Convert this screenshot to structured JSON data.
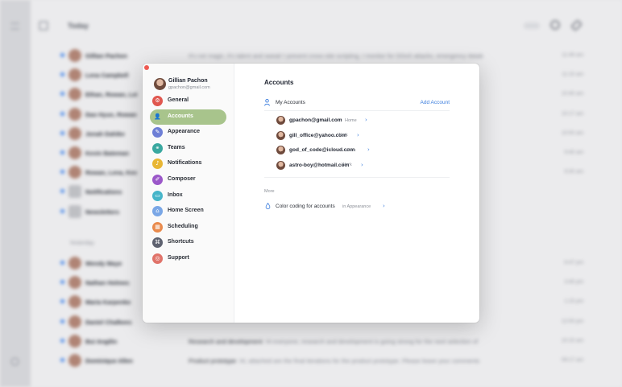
{
  "background": {
    "title": "Today",
    "section_yesterday": "Yesterday",
    "rows_today": [
      {
        "from": "Gillian Pachon",
        "subject": "",
        "preview": "It's not magic, it's talent and sweat! I prevent cross-site scripting, I monitor for DDoS attacks, emergency datab",
        "time": "11:49 am",
        "group": false
      },
      {
        "from": "Lena Campbell",
        "subject": "",
        "preview": "ewed. It seems as t",
        "time": "11:15 am",
        "group": false
      },
      {
        "from": "Ethan, Rowan, Lei",
        "subject": "",
        "preview": "Google, lowercase",
        "time": "10:45 am",
        "group": false
      },
      {
        "from": "Dao Hyun, Rowan",
        "subject": "",
        "preview": "bout all the late",
        "time": "10:17 am",
        "group": false
      },
      {
        "from": "Jonah Dahike",
        "subject": "",
        "preview": "",
        "time": "10:00 am",
        "group": false
      },
      {
        "from": "Kevin Bateman",
        "subject": "",
        "preview": "to be done today",
        "time": "9:45 am",
        "group": false
      },
      {
        "from": "Rowan, Lena, Kev",
        "subject": "",
        "preview": "",
        "time": "9:30 am",
        "group": false
      },
      {
        "from": "Notifications",
        "subject": "",
        "preview": "",
        "time": "",
        "group": true
      },
      {
        "from": "Newsletters",
        "subject": "",
        "preview": "",
        "time": "",
        "group": true
      }
    ],
    "rows_yesterday": [
      {
        "from": "Wendy Maye",
        "subject": "",
        "preview": "ant tone and explor",
        "time": "6:47 pm"
      },
      {
        "from": "Nathan Holmes",
        "subject": "",
        "preview": "ed and wanted to",
        "time": "3:45 pm"
      },
      {
        "from": "Maria Karpenko",
        "subject": "",
        "preview": "nmation material for tod",
        "time": "1:15 pm"
      },
      {
        "from": "Daniel Chalkees",
        "subject": "",
        "preview": "",
        "time": "12:00 pm"
      },
      {
        "from": "Bui Angilin",
        "subject": "Research and development",
        "preview": "Hi everyone, research and development is going strong for the next selection of",
        "time": "10:15 am"
      },
      {
        "from": "Dominique Allen",
        "subject": "Product prototype",
        "preview": "Hi, attached are the final iterations for the product prototype. Please leave your comments",
        "time": "09:17 am"
      }
    ]
  },
  "dialog": {
    "user": {
      "name": "Gillian Pachon",
      "email": "gpachon@gmail.com"
    },
    "nav": [
      {
        "label": "General",
        "icon": "gear-icon",
        "glyph": "⚙",
        "color": "#e0574f",
        "active": false
      },
      {
        "label": "Accounts",
        "icon": "person-icon",
        "glyph": "👤",
        "color": "#a8c48c",
        "active": true
      },
      {
        "label": "Appearance",
        "icon": "brush-icon",
        "glyph": "✎",
        "color": "#6e7fd6",
        "active": false
      },
      {
        "label": "Teams",
        "icon": "team-icon",
        "glyph": "⚭",
        "color": "#3aa8a0",
        "active": false
      },
      {
        "label": "Notifications",
        "icon": "bell-icon",
        "glyph": "♪",
        "color": "#e8b634",
        "active": false
      },
      {
        "label": "Composer",
        "icon": "pencil-icon",
        "glyph": "✐",
        "color": "#9b58c9",
        "active": false
      },
      {
        "label": "Inbox",
        "icon": "inbox-icon",
        "glyph": "▭",
        "color": "#46b5c9",
        "active": false
      },
      {
        "label": "Home Screen",
        "icon": "home-icon",
        "glyph": "⌂",
        "color": "#7aa7e6",
        "active": false
      },
      {
        "label": "Scheduling",
        "icon": "calendar-icon",
        "glyph": "▦",
        "color": "#e98a4c",
        "active": false
      },
      {
        "label": "Shortcuts",
        "icon": "command-icon",
        "glyph": "⌘",
        "color": "#5e6270",
        "active": false
      },
      {
        "label": "Support",
        "icon": "lifebuoy-icon",
        "glyph": "◎",
        "color": "#e0736a",
        "active": false
      }
    ],
    "main": {
      "heading": "Accounts",
      "my_accounts_label": "My Accounts",
      "add_account_label": "Add Account",
      "accounts": [
        {
          "email": "gpachon@gmail.com",
          "tag": "Home"
        },
        {
          "email": "gill_office@yahoo.com",
          "tag": "Work"
        },
        {
          "email": "god_of_code@icloud.com",
          "tag": "Work"
        },
        {
          "email": "astro-boy@hotmail.com",
          "tag": "Work"
        }
      ],
      "more_label": "More",
      "color_coding_label": "Color coding for accounts",
      "color_coding_location": "in Appearance"
    }
  },
  "colors": {
    "accent": "#3b7ddd",
    "active_nav": "#a8c48c",
    "close": "#ee5a52",
    "unread": "#4a8ef5"
  }
}
